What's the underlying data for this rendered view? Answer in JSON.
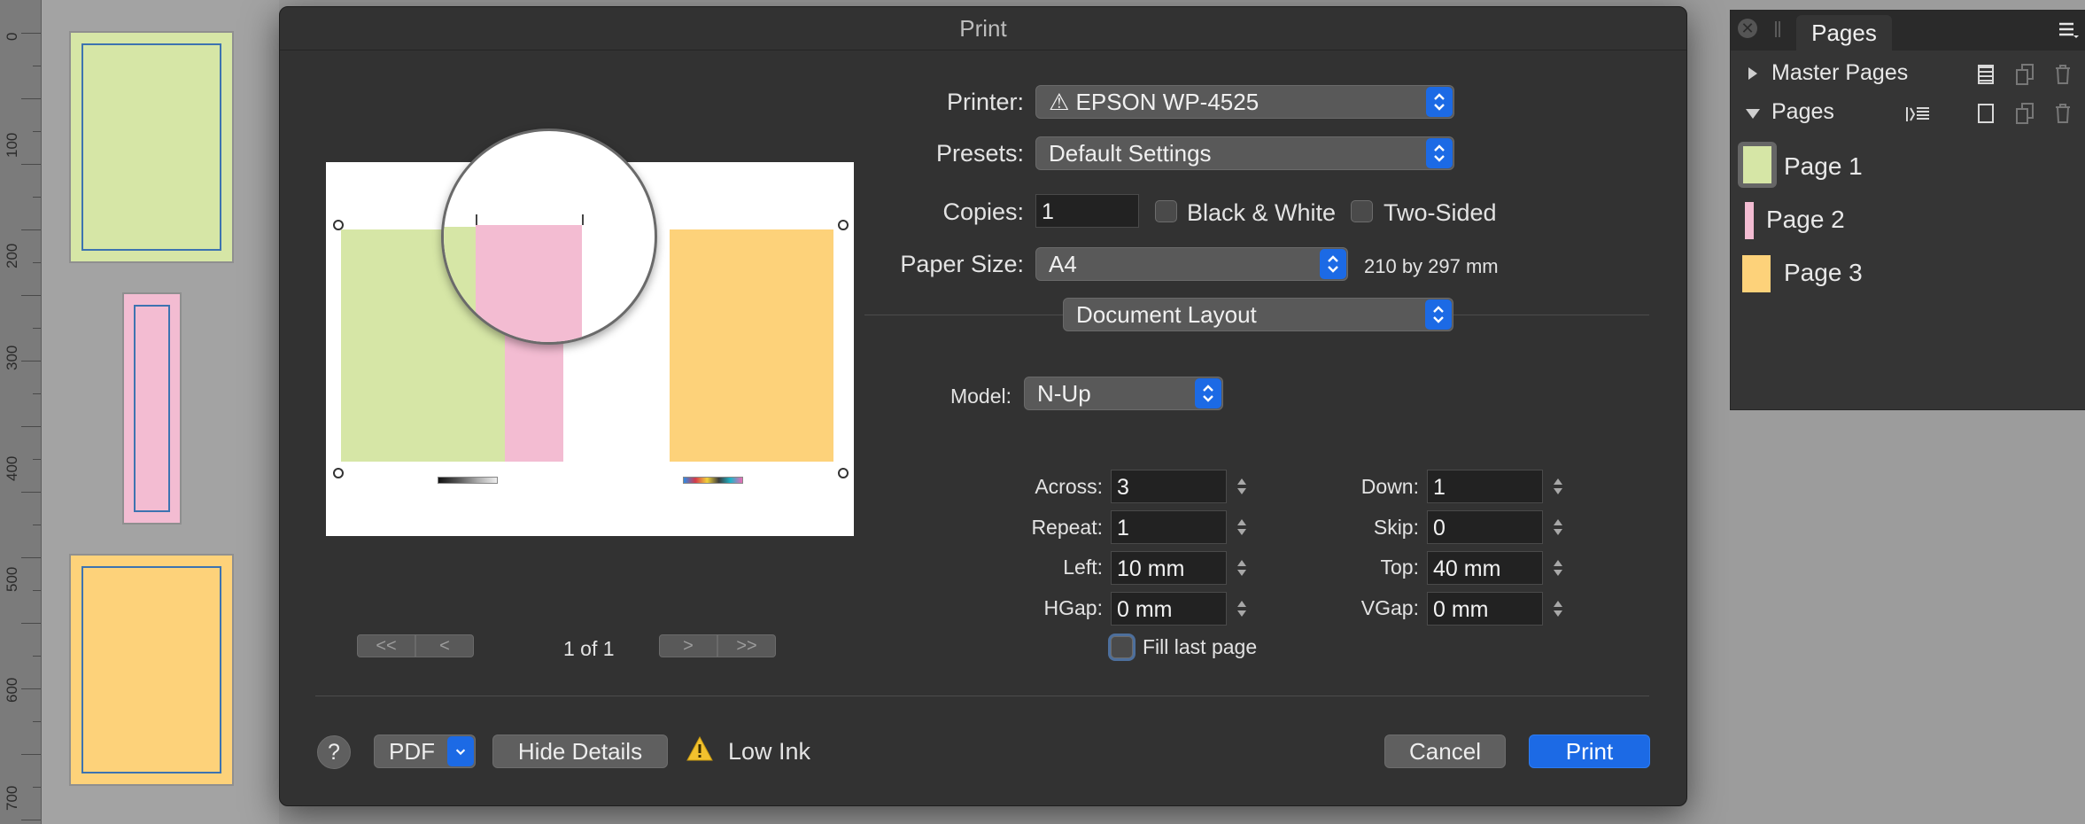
{
  "ruler": {
    "labels": [
      "0",
      "100",
      "200",
      "300",
      "400",
      "500",
      "600",
      "700"
    ]
  },
  "thumbnails": [
    {
      "name": "page-1-thumb",
      "color": "#d6e6a6"
    },
    {
      "name": "page-2-thumb",
      "color": "#f3bcd2"
    },
    {
      "name": "page-3-thumb",
      "color": "#fdd27a"
    }
  ],
  "dialog": {
    "title": "Print",
    "printer": {
      "label": "Printer:",
      "value": "⚠ EPSON WP-4525"
    },
    "presets": {
      "label": "Presets:",
      "value": "Default Settings"
    },
    "copies": {
      "label": "Copies:",
      "value": "1"
    },
    "black_white": {
      "label": "Black & White",
      "checked": false
    },
    "two_sided": {
      "label": "Two-Sided",
      "checked": false
    },
    "paper_size": {
      "label": "Paper Size:",
      "value": "A4",
      "dimensions": "210 by 297 mm"
    },
    "section": "Document Layout",
    "model": {
      "label": "Model:",
      "value": "N-Up"
    },
    "fields": {
      "across": {
        "label": "Across:",
        "value": "3"
      },
      "repeat": {
        "label": "Repeat:",
        "value": "1"
      },
      "left": {
        "label": "Left:",
        "value": "10 mm"
      },
      "hgap": {
        "label": "HGap:",
        "value": "0 mm"
      },
      "down": {
        "label": "Down:",
        "value": "1"
      },
      "skip": {
        "label": "Skip:",
        "value": "0"
      },
      "top": {
        "label": "Top:",
        "value": "40 mm"
      },
      "vgap": {
        "label": "VGap:",
        "value": "0 mm"
      }
    },
    "fill_last_page": {
      "label": "Fill last page",
      "checked": false
    },
    "preview": {
      "page_indicator": "1 of 1",
      "nav": [
        "<<",
        "<",
        ">",
        ">>"
      ]
    },
    "footer": {
      "help": "?",
      "pdf": "PDF",
      "hide_details": "Hide Details",
      "warning": "Low Ink",
      "cancel": "Cancel",
      "print": "Print"
    },
    "colors": {
      "accent": "#1c6ae5",
      "warning": "#f2c12e"
    }
  },
  "pages_panel": {
    "tab": "Pages",
    "sections": [
      {
        "label": "Master Pages",
        "expanded": false
      },
      {
        "label": "Pages",
        "expanded": true
      }
    ],
    "pages": [
      {
        "label": "Page 1",
        "color": "#d6e6a6",
        "selected": true
      },
      {
        "label": "Page 2",
        "color": "#f3bcd2",
        "selected": false
      },
      {
        "label": "Page 3",
        "color": "#fdd27a",
        "selected": false
      }
    ]
  }
}
